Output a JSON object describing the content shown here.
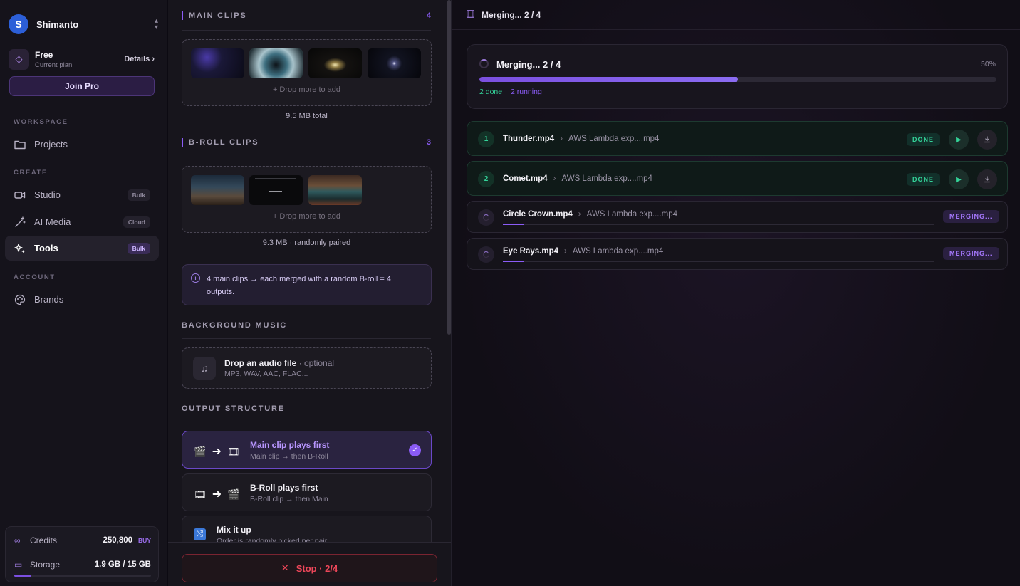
{
  "sidebar": {
    "brand_initial": "S",
    "brand_name": "Shimanto",
    "plan_title": "Free",
    "plan_sub": "Current plan",
    "details": "Details ›",
    "join_pro": "Join Pro",
    "sections": {
      "workspace": "WORKSPACE",
      "create": "CREATE",
      "account": "ACCOUNT"
    },
    "items": [
      {
        "label": "Projects",
        "icon": "folder-icon",
        "badge": ""
      },
      {
        "label": "Studio",
        "icon": "video-camera-icon",
        "badge": "Bulk"
      },
      {
        "label": "AI Media",
        "icon": "magic-wand-icon",
        "badge": "Cloud"
      },
      {
        "label": "Tools",
        "icon": "sparkles-icon",
        "badge": "Bulk"
      },
      {
        "label": "Brands",
        "icon": "palette-icon",
        "badge": ""
      }
    ],
    "credits_label": "Credits",
    "credits_value": "250,800",
    "buy": "BUY",
    "storage_label": "Storage",
    "storage_value": "1.9 GB / 15 GB",
    "storage_fraction": 0.127
  },
  "middle": {
    "main_clips": {
      "title": "MAIN CLIPS",
      "count": "4",
      "drop_more": "+ Drop more to add",
      "size": "9.5 MB total"
    },
    "broll_clips": {
      "title": "B-ROLL CLIPS",
      "count": "3",
      "drop_more": "+ Drop more to add",
      "size": "9.3 MB · randomly paired"
    },
    "info": "4 main clips → each merged with a random B-roll = 4 outputs.",
    "music": {
      "title": "BACKGROUND MUSIC",
      "drop_title": "Drop an audio file",
      "optional": " · optional",
      "formats": "MP3, WAV, AAC, FLAC..."
    },
    "output": {
      "title": "OUTPUT STRUCTURE",
      "options": [
        {
          "title": "Main clip plays first",
          "sub": "Main clip → then B-Roll",
          "icon_a": "clapper-icon",
          "icon_b": "film-icon",
          "selected": true
        },
        {
          "title": "B-Roll plays first",
          "sub": "B-Roll clip → then Main",
          "icon_a": "film-icon",
          "icon_b": "clapper-icon",
          "selected": false
        },
        {
          "title": "Mix it up",
          "sub": "Order is randomly picked per pair",
          "icon_a": "shuffle-icon",
          "selected": false
        }
      ]
    },
    "stop": "Stop · 2/4"
  },
  "right": {
    "header": "Merging... 2 / 4",
    "progress_title": "Merging... 2 / 4",
    "progress_pct": "50%",
    "progress_fraction": 0.5,
    "done_text": "2 done",
    "running_text": "2 running",
    "jobs": [
      {
        "num": "1",
        "name": "Thunder.mp4",
        "source": "AWS Lambda exp....mp4",
        "status": "DONE"
      },
      {
        "num": "2",
        "name": "Comet.mp4",
        "source": "AWS Lambda exp....mp4",
        "status": "DONE"
      },
      {
        "num": "",
        "name": "Circle Crown.mp4",
        "source": "AWS Lambda exp....mp4",
        "status": "MERGING...",
        "progress": 0.05
      },
      {
        "num": "",
        "name": "Eye Rays.mp4",
        "source": "AWS Lambda exp....mp4",
        "status": "MERGING...",
        "progress": 0.05
      }
    ]
  },
  "colors": {
    "accent": "#8b5cf6",
    "success": "#34d399",
    "danger": "#f0475a"
  }
}
